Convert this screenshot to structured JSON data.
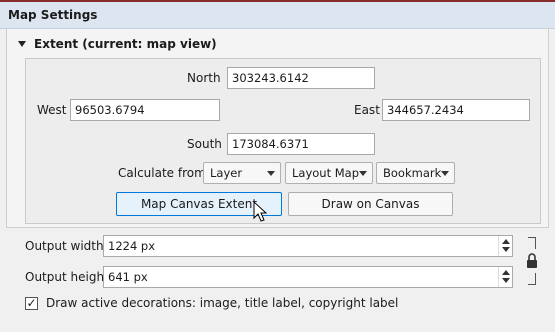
{
  "header": {
    "title": "Map Settings"
  },
  "extent": {
    "title": "Extent (current: map view)",
    "north_label": "North",
    "north_value": "303243.6142",
    "west_label": "West",
    "west_value": "96503.6794",
    "east_label": "East",
    "east_value": "344657.2434",
    "south_label": "South",
    "south_value": "173084.6371",
    "calculate_from_label": "Calculate from",
    "layer_combo": "Layer",
    "layout_map_combo": "Layout Map",
    "bookmark_combo": "Bookmark",
    "map_canvas_button": "Map Canvas Extent",
    "draw_canvas_button": "Draw on Canvas"
  },
  "output": {
    "width_label": "Output width",
    "width_value": "1224 px",
    "height_label": "Output height",
    "height_value": "641 px"
  },
  "decorations": {
    "checked": true,
    "check_mark": "✓",
    "label": "Draw active decorations: image, title label, copyright label"
  }
}
